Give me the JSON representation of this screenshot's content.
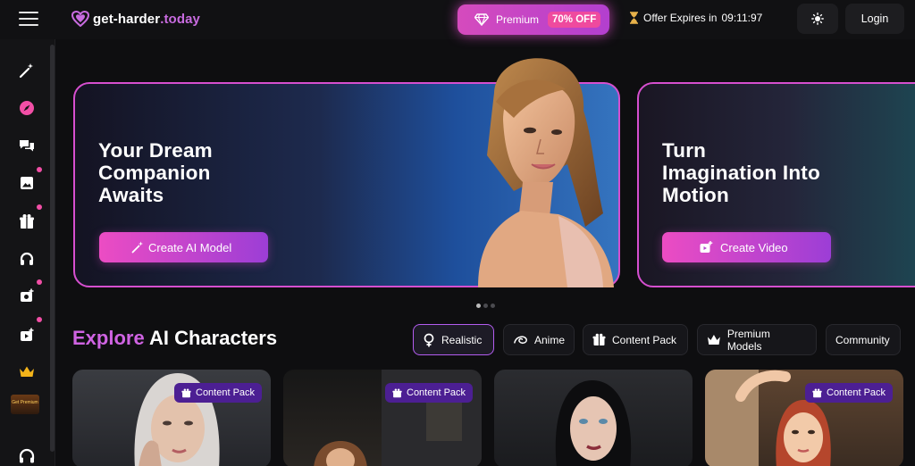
{
  "header": {
    "logo_prefix": "get-harder",
    "logo_suffix": ".today",
    "premium_label": "Premium",
    "premium_discount": "70% OFF",
    "offer_label": "Offer Expires in",
    "offer_timer": "09:11:97",
    "login_label": "Login",
    "accent_color": "#c86bdf"
  },
  "sidebar": {
    "items": [
      "magic-wand-icon",
      "compass-icon",
      "chat-icon",
      "image-icon",
      "gift-box-icon",
      "headset-icon",
      "add-photo-icon",
      "add-video-icon",
      "crown-icon"
    ],
    "promo_text": "Get Premium",
    "active_color": "#f24fa6"
  },
  "hero": {
    "slide1_title": "Your Dream Companion Awaits",
    "slide1_title_lines": [
      "Your Dream",
      "Companion",
      "Awaits"
    ],
    "slide1_button": "Create AI Model",
    "slide2_title_lines": [
      "Turn",
      "Imagination Into",
      "Motion"
    ],
    "slide2_button": "Create Video",
    "slide_count": 3,
    "active_slide": 1
  },
  "explore": {
    "title_highlight": "Explore",
    "title_rest": "AI Characters",
    "filters": [
      {
        "label": "Realistic",
        "active": true
      },
      {
        "label": "Anime",
        "active": false
      },
      {
        "label": "Content Pack",
        "active": false
      },
      {
        "label": "Premium Models",
        "active": false
      },
      {
        "label": "Community",
        "active": false
      }
    ]
  },
  "cards": [
    {
      "badge": "Content Pack"
    },
    {
      "badge": "Content Pack"
    },
    {
      "badge": ""
    },
    {
      "badge": "Content Pack"
    }
  ]
}
